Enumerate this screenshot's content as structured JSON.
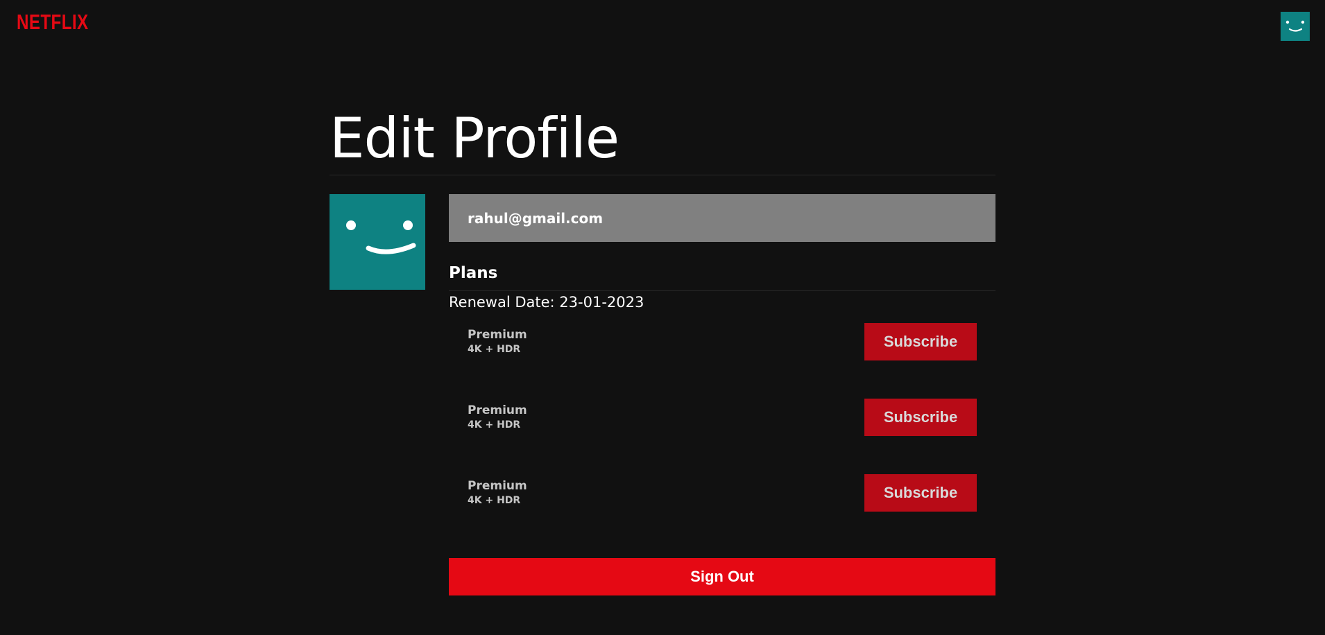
{
  "header": {
    "logo_text": "NETFLIX",
    "avatar_icon": "smiley-profile-icon"
  },
  "main": {
    "title": "Edit Profile",
    "avatar_icon": "smiley-profile-icon",
    "email": "rahul@gmail.com",
    "plans_heading": "Plans",
    "renewal_date": "Renewal Date: 23-01-2023",
    "plans": [
      {
        "name": "Premium",
        "description": "4K + HDR",
        "button_label": "Subscribe"
      },
      {
        "name": "Premium",
        "description": "4K + HDR",
        "button_label": "Subscribe"
      },
      {
        "name": "Premium",
        "description": "4K + HDR",
        "button_label": "Subscribe"
      }
    ],
    "signout_label": "Sign Out"
  },
  "colors": {
    "background": "#111111",
    "brand_red": "#E50914",
    "subscribe_red": "#B80B17",
    "avatar_teal": "#0E8282",
    "email_box": "#808080"
  }
}
